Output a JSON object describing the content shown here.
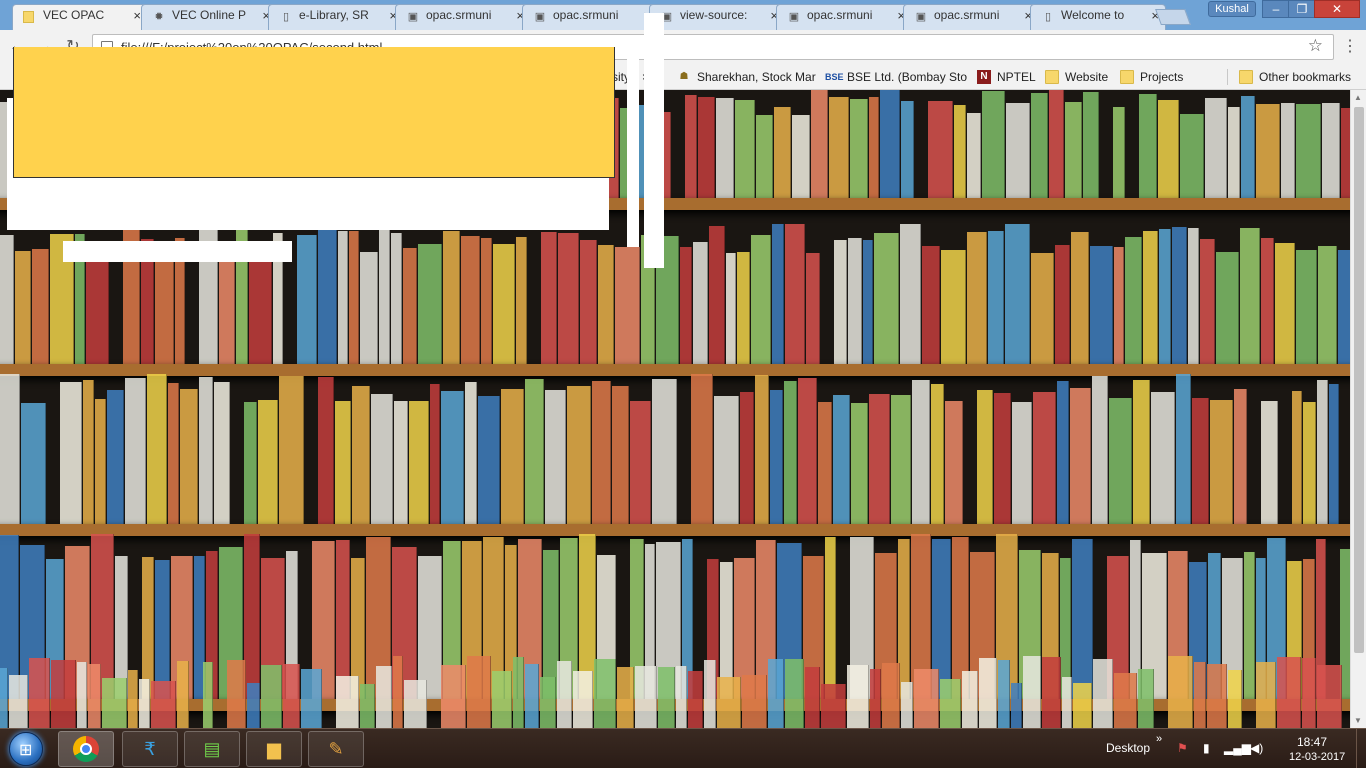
{
  "browser": {
    "tabs": [
      {
        "title": "VEC OPAC",
        "favicon": "folder-icon",
        "active": true
      },
      {
        "title": "VEC Online P",
        "favicon": "gear-icon",
        "active": false
      },
      {
        "title": "e-Library, SR",
        "favicon": "page-icon",
        "active": false
      },
      {
        "title": "opac.srmuni",
        "favicon": "image-icon",
        "active": false
      },
      {
        "title": "opac.srmuni",
        "favicon": "image-icon",
        "active": false
      },
      {
        "title": "view-source:",
        "favicon": "image-icon",
        "active": false
      },
      {
        "title": "opac.srmuni",
        "favicon": "image-icon",
        "active": false
      },
      {
        "title": "opac.srmuni",
        "favicon": "image-icon",
        "active": false
      },
      {
        "title": "Welcome to",
        "favicon": "page-icon",
        "active": false
      }
    ],
    "tab_close_glyph": "×",
    "user": "Kushal",
    "window_controls": {
      "minimize": "–",
      "maximize": "❐",
      "close": "✕"
    },
    "address": "file:///F:/project%20on%20OPAC/second.html",
    "nav": {
      "back": "←",
      "forward": "→",
      "reload": "↻"
    },
    "star": "☆",
    "menu": "⋮",
    "bookmarks": [
      {
        "label": "sity",
        "icon": "none"
      },
      {
        "label": "Sharekhan, Stock Mar",
        "icon": "sharekhan-icon"
      },
      {
        "label": "BSE Ltd. (Bombay Sto",
        "icon": "bse-icon"
      },
      {
        "label": "NPTEL",
        "icon": "nptel-icon"
      },
      {
        "label": "Website",
        "icon": "folder-icon"
      },
      {
        "label": "Projects",
        "icon": "folder-icon"
      }
    ],
    "other_bookmarks": "Other bookmarks"
  },
  "page": {
    "background": "library-bookshelf-photo",
    "colors": {
      "panel_yellow": "#ffd24d",
      "panel_white": "#ffffff"
    }
  },
  "taskbar": {
    "apps": [
      {
        "name": "chrome",
        "icon": "chrome-icon"
      },
      {
        "name": "finance",
        "icon": "rupee-icon"
      },
      {
        "name": "charts",
        "icon": "chart-icon"
      },
      {
        "name": "explorer",
        "icon": "folder-icon"
      },
      {
        "name": "paint",
        "icon": "palette-icon"
      }
    ],
    "desktop_label": "Desktop",
    "chevron": "»",
    "time": "18:47",
    "date": "12-03-2017"
  }
}
